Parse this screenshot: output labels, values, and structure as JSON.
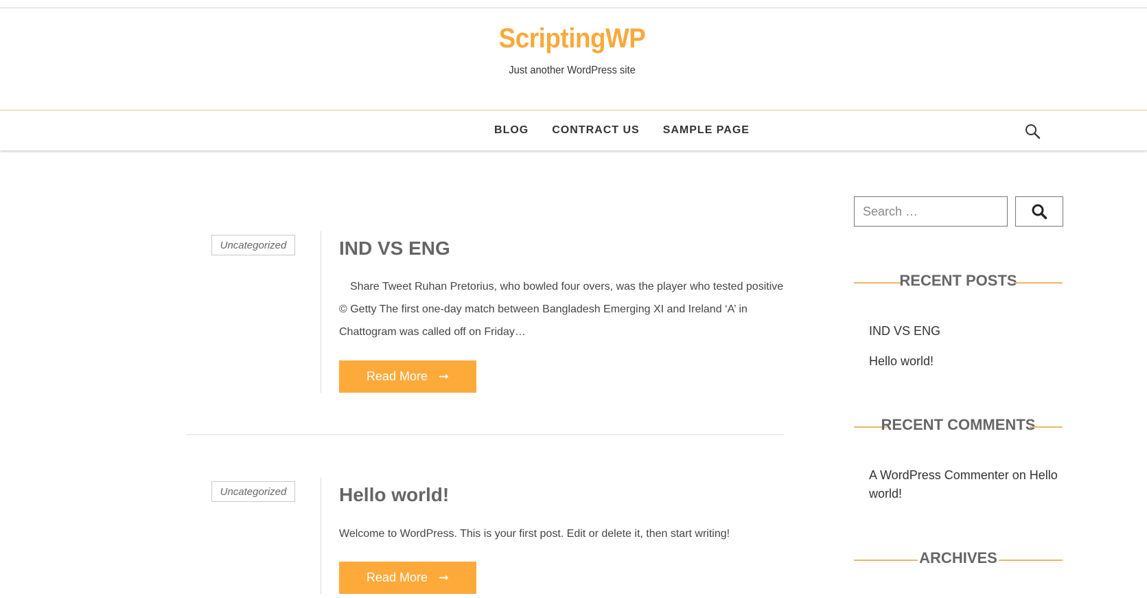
{
  "site": {
    "title": "ScriptingWP",
    "tagline": "Just another WordPress site"
  },
  "nav": {
    "items": [
      "BLOG",
      "CONTRACT US",
      "SAMPLE PAGE"
    ]
  },
  "posts": [
    {
      "category": "Uncategorized",
      "title": "IND VS ENG",
      "excerpt": "Share Tweet Ruhan Pretorius, who bowled four overs, was the player who tested positive © Getty The first one-day match between Bangladesh Emerging XI and Ireland ‘A’ in Chattogram was called off on Friday…",
      "read_more": "Read More"
    },
    {
      "category": "Uncategorized",
      "title": "Hello world!",
      "excerpt": "Welcome to WordPress. This is your first post. Edit or delete it, then start writing!",
      "read_more": "Read More"
    }
  ],
  "sidebar": {
    "search": {
      "placeholder": "Search …"
    },
    "recent_posts": {
      "title": "RECENT POSTS",
      "items": [
        "IND VS ENG",
        "Hello world!"
      ]
    },
    "recent_comments": {
      "title": "RECENT COMMENTS",
      "author": "A WordPress Commenter",
      "on": "on",
      "post": "Hello world!"
    },
    "archives": {
      "title": "ARCHIVES"
    }
  },
  "colors": {
    "accent": "#fdaa3b",
    "title": "#f9a93a",
    "heading": "#666666"
  }
}
